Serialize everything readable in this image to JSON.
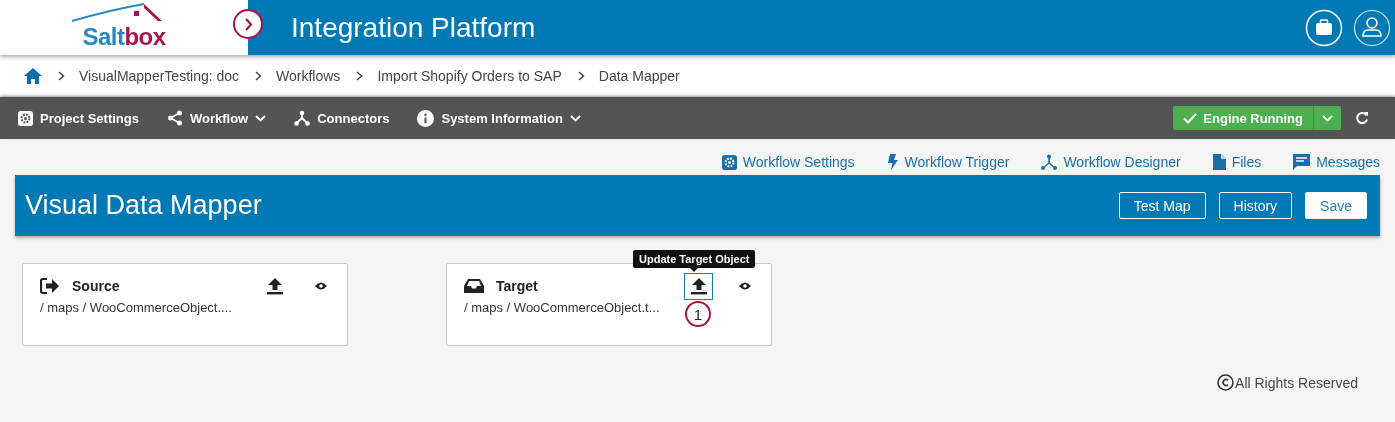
{
  "header": {
    "logo_parts": [
      "Salt",
      "box"
    ],
    "title": "Integration Platform"
  },
  "breadcrumbs": [
    "VisualMapperTesting: doc",
    "Workflows",
    "Import Shopify Orders to SAP",
    "Data Mapper"
  ],
  "toolbar": {
    "items": [
      {
        "label": "Project Settings",
        "kind": "settings",
        "dropdown": false
      },
      {
        "label": "Workflow",
        "kind": "share",
        "dropdown": true
      },
      {
        "label": "Connectors",
        "kind": "connectors",
        "dropdown": false
      },
      {
        "label": "System Information",
        "kind": "info",
        "dropdown": true
      }
    ],
    "engine_status": "Engine Running"
  },
  "links": [
    {
      "label": "Workflow Settings",
      "kind": "settings"
    },
    {
      "label": "Workflow Trigger",
      "kind": "bolt"
    },
    {
      "label": "Workflow Designer",
      "kind": "designer"
    },
    {
      "label": "Files",
      "kind": "file"
    },
    {
      "label": "Messages",
      "kind": "message"
    }
  ],
  "mapper": {
    "title": "Visual Data Mapper",
    "buttons": [
      {
        "label": "Test Map",
        "filled": false
      },
      {
        "label": "History",
        "filled": false
      },
      {
        "label": "Save",
        "filled": true
      }
    ]
  },
  "cards": [
    {
      "kind": "source",
      "title": "Source",
      "path": "/ maps / WooCommerceObject....",
      "highlighted": false
    },
    {
      "kind": "target",
      "title": "Target",
      "path": "/ maps / WooCommerceObject.t...",
      "highlighted": true,
      "tooltip": "Update Target Object",
      "callout": "1"
    }
  ],
  "footer": "All Rights Reserved"
}
